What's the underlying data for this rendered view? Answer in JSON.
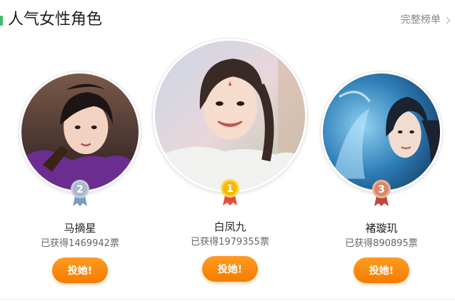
{
  "section": {
    "title": "人气女性角色",
    "more_link": "完整榜单"
  },
  "colors": {
    "accent": "#3dbf6a",
    "button": "#f98a0b",
    "medal_gold": "#f5b800",
    "medal_silver": "#a9b7c6",
    "medal_bronze": "#d9876a"
  },
  "characters": [
    {
      "rank": "2",
      "name": "马摘星",
      "votes": "已获得1469942票",
      "button": "投她!"
    },
    {
      "rank": "1",
      "name": "白凤九",
      "votes": "已获得1979355票",
      "button": "投她!"
    },
    {
      "rank": "3",
      "name": "褚璇玑",
      "votes": "已获得890895票",
      "button": "投她!"
    }
  ]
}
